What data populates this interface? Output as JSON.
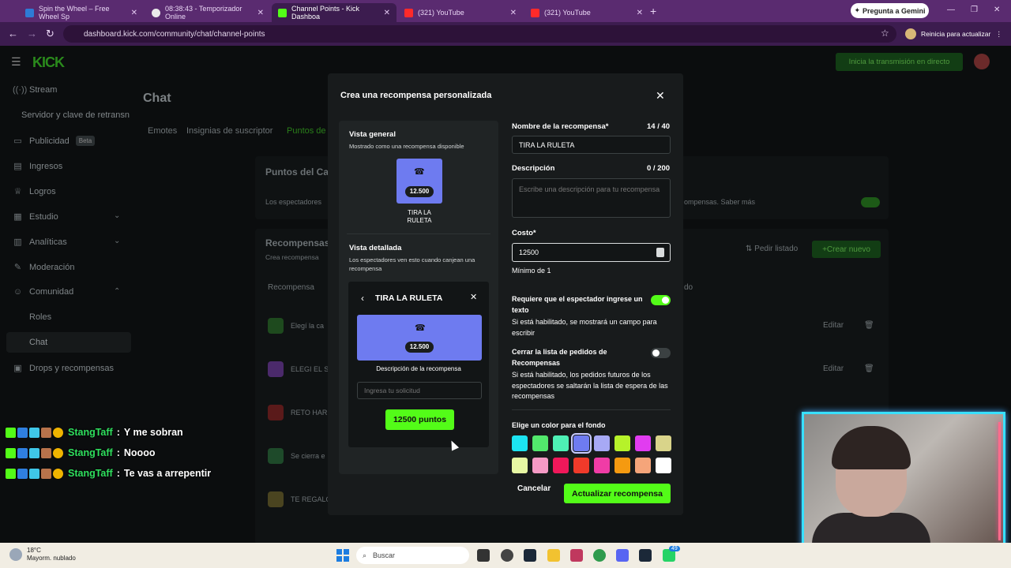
{
  "browser": {
    "tabs": [
      {
        "title": "Spin the Wheel – Free Wheel Sp",
        "color": "#2e7bd6"
      },
      {
        "title": "08:38:43 - Temporizador Online",
        "color": "#eaeaea"
      },
      {
        "title": "Channel Points - Kick Dashboa",
        "color": "#53fc18"
      },
      {
        "title": "(321) YouTube",
        "color": "#ff2a2a"
      },
      {
        "title": "(321) YouTube",
        "color": "#ff2a2a"
      }
    ],
    "gemini_label": "Pregunta a Gemini",
    "url": "dashboard.kick.com/community/chat/channel-points",
    "restart_label": "Reinicia para actualizar"
  },
  "dashboard": {
    "logo": "KICK",
    "go_live": "Inicia la transmisión en directo",
    "sidebar": [
      {
        "icon": "((·))",
        "label": "Stream"
      },
      {
        "icon": "",
        "label": "Servidor y clave de retransn"
      },
      {
        "icon": "▭",
        "label": "Publicidad",
        "badge": "Beta"
      },
      {
        "icon": "▤",
        "label": "Ingresos"
      },
      {
        "icon": "🏆",
        "label": "Logros"
      },
      {
        "icon": "▦",
        "label": "Estudio"
      },
      {
        "icon": "▥",
        "label": "Analíticas"
      },
      {
        "icon": "✎",
        "label": "Moderación"
      },
      {
        "icon": "☺",
        "label": "Comunidad"
      },
      {
        "icon": "",
        "label": "Roles"
      },
      {
        "icon": "",
        "label": "Chat"
      },
      {
        "icon": "▣",
        "label": "Drops y recompensas"
      }
    ],
    "page_title": "Chat",
    "tabs": [
      "Emotes",
      "Insignias de suscriptor",
      "Puntos de"
    ],
    "section_title": "Puntos del Ca",
    "section_desc_left": "Los espectadores",
    "section_desc_right": "ompensas. Saber más",
    "rewards_title": "Recompensas",
    "rewards_sub": "Crea recompensa",
    "pedir_listado": "Pedir listado",
    "crear_nuevo": "Crear nuevo",
    "col_reward": "Recompensa",
    "col_other": "do",
    "rows": [
      "Elegí la ca",
      "ELEGI EL S",
      "RETO HAR",
      "Se cierra e",
      "TE REGALO"
    ],
    "edit_label": "Editar"
  },
  "chat": [
    {
      "user": "StangTaff",
      "message": "Y me sobran"
    },
    {
      "user": "StangTaff",
      "message": "Noooo"
    },
    {
      "user": "StangTaff",
      "message": "Te vas a arrepentir"
    }
  ],
  "modal": {
    "title": "Crea una recompensa personalizada",
    "preview": {
      "overview_title": "Vista general",
      "overview_sub": "Mostrado como una recompensa disponible",
      "card_cost": "12.500",
      "card_name": "TIRA LA RULETA",
      "detail_title": "Vista detallada",
      "detail_sub": "Los espectadores ven esto cuando canjean una recompensa",
      "detail_header": "TIRA LA RULETA",
      "detail_cost": "12.500",
      "detail_desc": "Descripción de la recompensa",
      "request_placeholder": "Ingresa tu solicitud",
      "redeem_button": "12500 puntos"
    },
    "form": {
      "name_label": "Nombre de la recompensa*",
      "name_count": "14 / 40",
      "name_value": "TIRA LA RULETA",
      "desc_label": "Descripción",
      "desc_count": "0 / 200",
      "desc_placeholder": "Escribe una descripción para tu recompensa",
      "cost_label": "Costo*",
      "cost_value": "12500",
      "cost_min": "Mínimo de 1",
      "require_text_label": "Requiere que el espectador ingrese un texto",
      "require_text_desc": "Si está habilitado, se mostrará un campo para escribir",
      "require_text_on": true,
      "close_list_label": "Cerrar la lista de pedidos de Recompensas",
      "close_list_desc": "Si está habilitado, los pedidos futuros de los espectadores se saltarán la lista de espera de las recompensas",
      "close_list_on": false,
      "color_label": "Elige un color para el fondo",
      "colors": [
        "#1ce4f2",
        "#52e86c",
        "#4ef0b5",
        "#6e7bf0",
        "#a7a9f5",
        "#b6f22a",
        "#e13cf0",
        "#d9d48a",
        "#e6f7a3",
        "#f59ac5",
        "#f0185a",
        "#f03a2a",
        "#f03ca6",
        "#f59a10",
        "#f5a57a",
        "#ffffff"
      ],
      "selected_color": "#6e7bf0",
      "cancel": "Cancelar",
      "submit": "Actualizar recompensa"
    }
  },
  "taskbar": {
    "temp": "18°C",
    "weather": "Mayorm. nublado",
    "search": "Buscar",
    "badge": "49"
  }
}
